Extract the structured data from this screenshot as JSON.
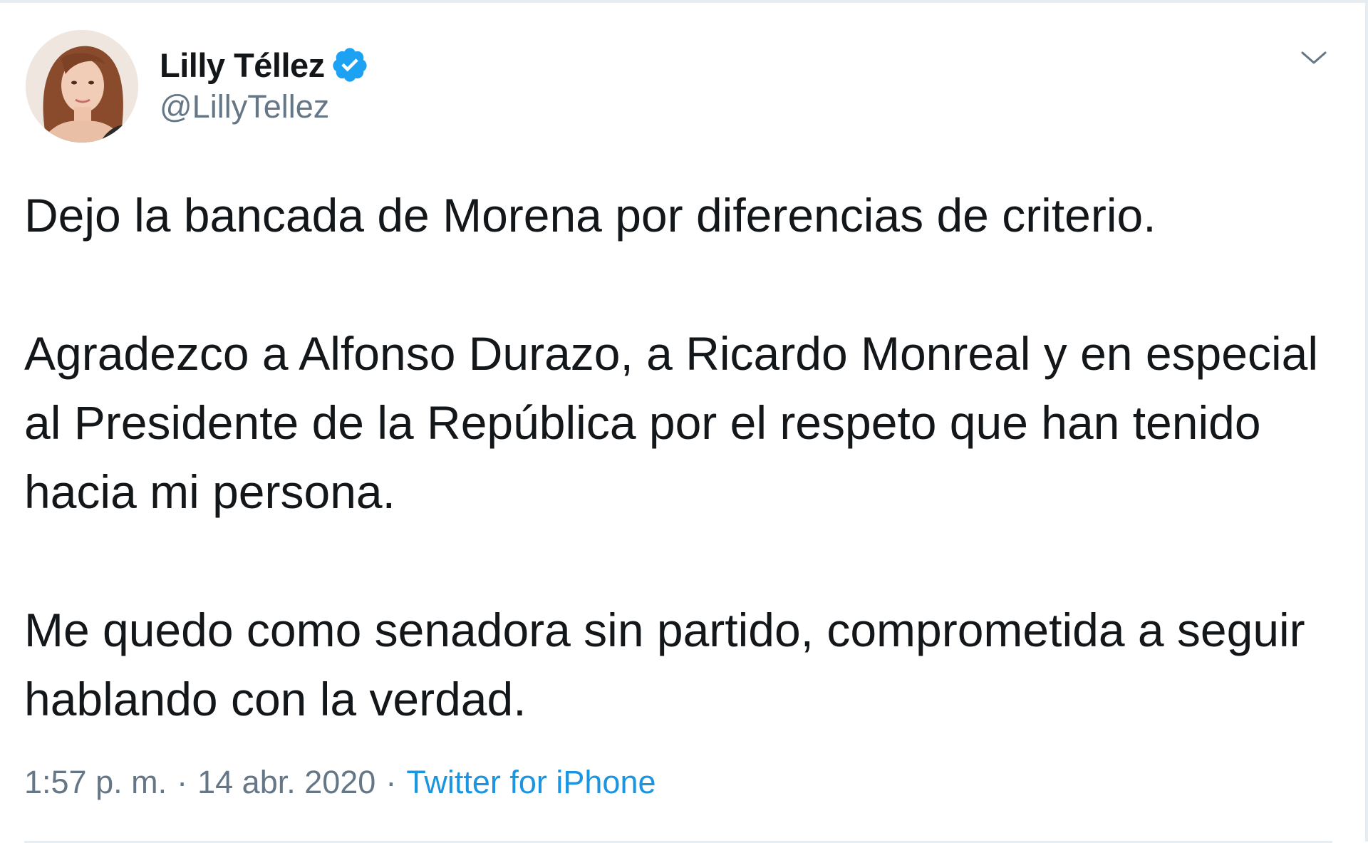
{
  "author": {
    "display_name": "Lilly Téllez",
    "handle": "@LillyTellez",
    "verified": true
  },
  "tweet": {
    "paragraphs": [
      "Dejo la bancada de Morena por diferencias de criterio.",
      "Agradezco a Alfonso Durazo, a Ricardo Monreal y en especial al Presidente de la República por el respeto que han tenido hacia mi persona.",
      "Me quedo como senadora sin partido, comprometida a seguir hablando con la verdad."
    ],
    "time": "1:57 p. m.",
    "separator": "·",
    "date": "14 abr. 2020",
    "source": "Twitter for iPhone"
  },
  "icons": {
    "verified": "verified-badge-icon",
    "menu": "chevron-down-icon"
  },
  "colors": {
    "text": "#14171a",
    "secondary": "#657786",
    "link": "#1b95e0",
    "verified": "#1da1f2"
  }
}
